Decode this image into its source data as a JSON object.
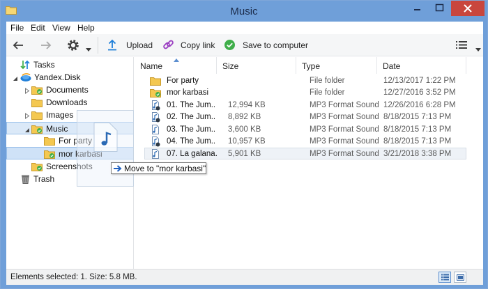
{
  "window": {
    "title": "Music"
  },
  "menu": [
    "File",
    "Edit",
    "View",
    "Help"
  ],
  "toolbar": {
    "upload": "Upload",
    "copy_link": "Copy link",
    "save": "Save to computer"
  },
  "tree": {
    "tasks": "Tasks",
    "root": "Yandex.Disk",
    "documents": "Documents",
    "downloads": "Downloads",
    "images": "Images",
    "music": "Music",
    "for_party": "For party",
    "mor_karbasi": "mor karbasi",
    "screenshots": "Screenshots",
    "trash": "Trash"
  },
  "columns": [
    "Name",
    "Size",
    "Type",
    "Date"
  ],
  "files": [
    {
      "name": "For party",
      "size": "",
      "type": "File folder",
      "date": "12/13/2017 1:22 PM",
      "kind": "folder"
    },
    {
      "name": "mor karbasi",
      "size": "",
      "type": "File folder",
      "date": "12/27/2016 3:52 PM",
      "kind": "folder-synced"
    },
    {
      "name": "01. The Jum...",
      "size": "12,994 KB",
      "type": "MP3 Format Sound",
      "date": "12/26/2016 6:28 PM",
      "kind": "audio"
    },
    {
      "name": "02. The Jum...",
      "size": "8,892 KB",
      "type": "MP3 Format Sound",
      "date": "8/18/2015 7:13 PM",
      "kind": "audio"
    },
    {
      "name": "03. The Jum...",
      "size": "3,600 KB",
      "type": "MP3 Format Sound",
      "date": "8/18/2015 7:13 PM",
      "kind": "audio"
    },
    {
      "name": "04. The Jum...",
      "size": "10,957 KB",
      "type": "MP3 Format Sound",
      "date": "8/18/2015 7:13 PM",
      "kind": "audio"
    },
    {
      "name": "07. La galana...",
      "size": "5,901 KB",
      "type": "MP3 Format Sound",
      "date": "3/21/2018 3:38 PM",
      "kind": "audio"
    }
  ],
  "drag": {
    "tooltip": "Move to \"mor karbasi\""
  },
  "status": {
    "text": "Elements selected: 1. Size: 5.8 MB."
  },
  "colors": {
    "accent": "#1f7fd8",
    "title_bar": "#6f9fd9",
    "close": "#c9463d",
    "folder": "#f4c851",
    "sync_green": "#3fae49"
  }
}
